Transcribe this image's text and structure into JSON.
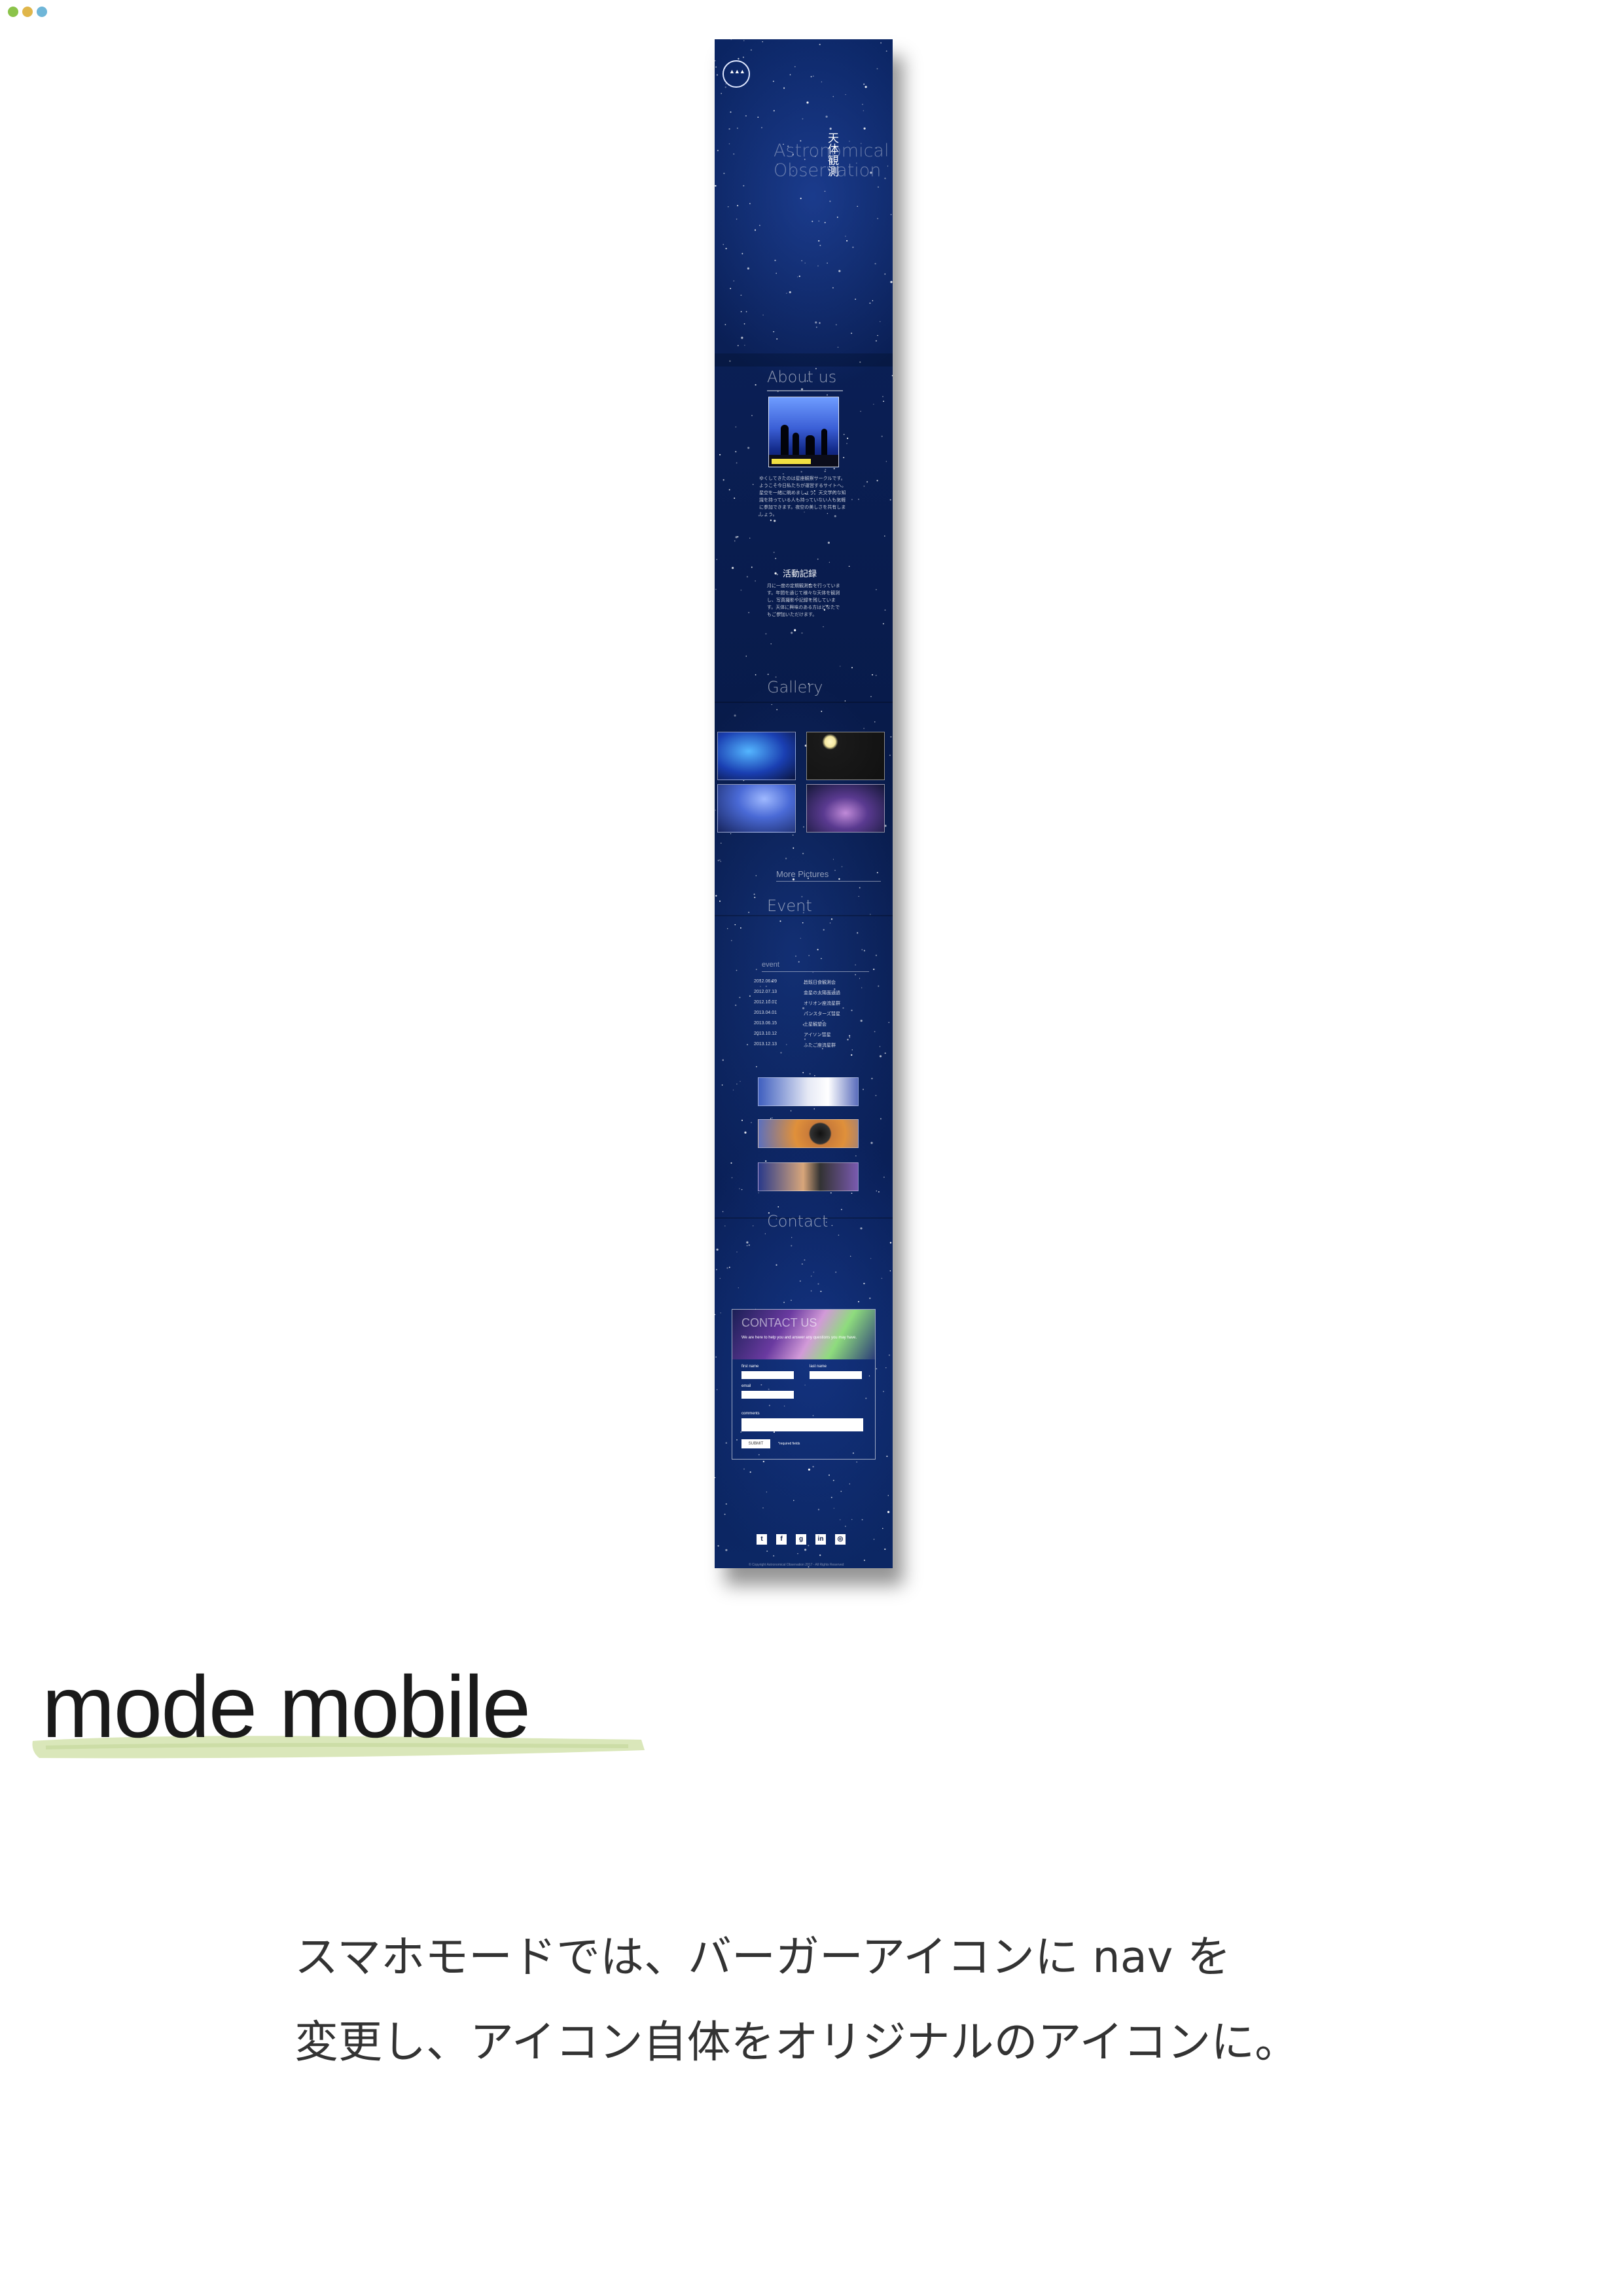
{
  "window": {
    "dot_colors": [
      "#8bc34a",
      "#e0b64a",
      "#6fb6d8"
    ]
  },
  "mock": {
    "hero": {
      "title_en": "Astronomical Observation",
      "title_jp": "天体観測"
    },
    "about": {
      "heading": "About us",
      "paragraph": "ゆくしてきたのは星座観察サークルです。ようこそ今日私たちが運営するサイトへ。星空を一緒に眺めましょう。天文学的な知識を持っている人も持っていない人も気軽に参加できます。夜空の美しさを共有しましょう。",
      "record_heading": "活動記録",
      "record_text": "月に一度の定期観測会を行っています。年間を通じて様々な天体を観測し、写真撮影や記録を残しています。天体に興味のある方はどなたでもご参加いただけます。"
    },
    "gallery": {
      "heading": "Gallery",
      "more_link": "More Pictures"
    },
    "event": {
      "heading": "Event",
      "table_label": "event",
      "rows": [
        {
          "date": "2012.06.09",
          "name": "皆既日食観測会"
        },
        {
          "date": "2012.07.13",
          "name": "金星の太陽面通過"
        },
        {
          "date": "2012.10.07",
          "name": "オリオン座流星群"
        },
        {
          "date": "2013.04.01",
          "name": "パンスターズ彗星"
        },
        {
          "date": "2013.06.15",
          "name": "土星観望会"
        },
        {
          "date": "2013.10.12",
          "name": "アイソン彗星"
        },
        {
          "date": "2013.12.13",
          "name": "ふたご座流星群"
        }
      ]
    },
    "contact": {
      "heading": "Contact",
      "form_title": "CONTACT US",
      "form_subtitle": "We are here to help you and answer any questions you may have.",
      "first_name_label": "first name",
      "last_name_label": "last name",
      "email_label": "email",
      "comments_label": "comments",
      "submit_label": "SUBMIT",
      "note": "*required fields"
    },
    "footer": {
      "socials": [
        "twitter-icon",
        "facebook-icon",
        "google-plus-icon",
        "linkedin-icon",
        "instagram-icon"
      ],
      "copyright": "© Copyright Astronomical Observation 2017 - All Rights Reserved"
    }
  },
  "heading": "mode mobile",
  "description": {
    "line1": "スマホモードでは、バーガーアイコンに nav を",
    "line2": "変更し、アイコン自体をオリジナルのアイコンに。"
  },
  "colors": {
    "brush": "#cfe0a8",
    "text": "#1a1a1a"
  }
}
